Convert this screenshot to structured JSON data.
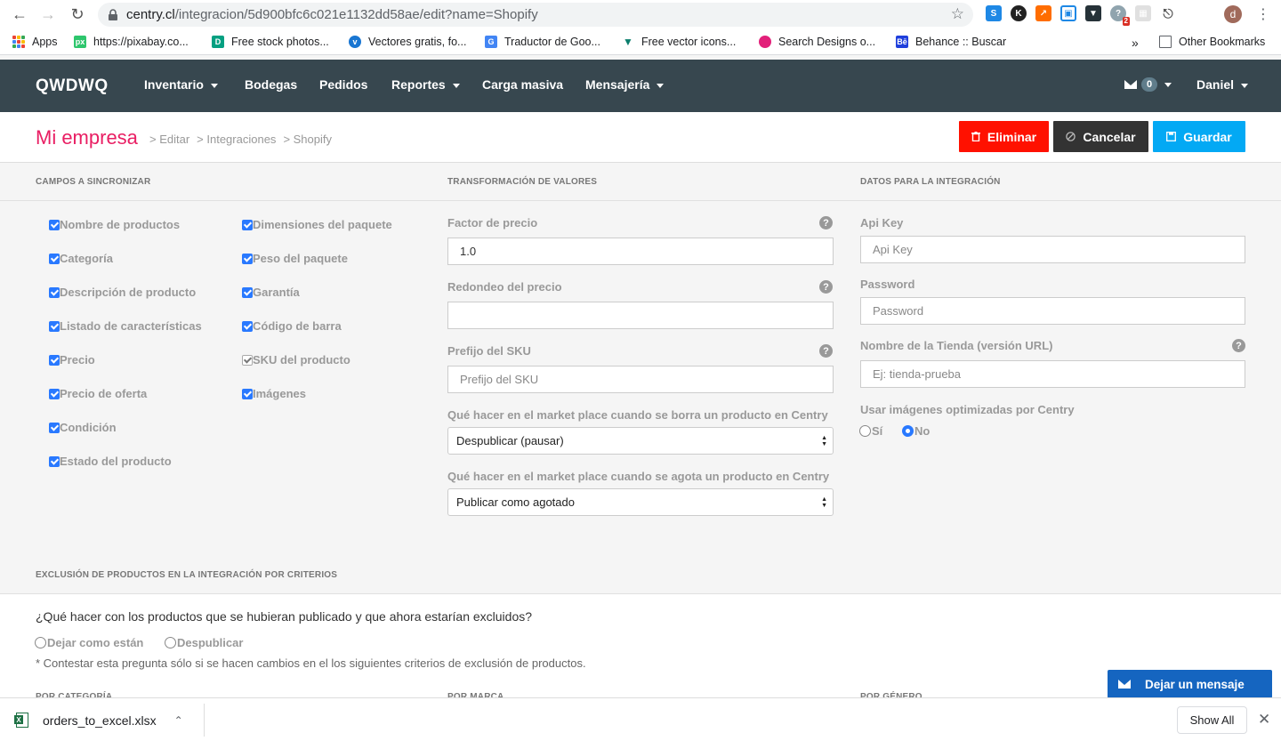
{
  "browser": {
    "url_host": "centry.cl",
    "url_path": "/integracion/5d900bfc6c021e1132dd58ae/edit?name=Shopify",
    "bookmarks": [
      {
        "label": "Apps"
      },
      {
        "label": "https://pixabay.co..."
      },
      {
        "label": "Free stock photos..."
      },
      {
        "label": "Vectores gratis, fo..."
      },
      {
        "label": "Traductor de Goo..."
      },
      {
        "label": "Free vector icons..."
      },
      {
        "label": "Search Designs o..."
      },
      {
        "label": "Behance :: Buscar"
      },
      {
        "label": "Other Bookmarks"
      }
    ],
    "ext_badge": "2",
    "profile_initial": "d"
  },
  "nav": {
    "brand": "QWDWQ",
    "items": [
      {
        "label": "Inventario",
        "dropdown": true
      },
      {
        "label": "Bodegas",
        "dropdown": false
      },
      {
        "label": "Pedidos",
        "dropdown": false
      },
      {
        "label": "Reportes",
        "dropdown": true
      },
      {
        "label": "Carga masiva",
        "dropdown": false
      },
      {
        "label": "Mensajería",
        "dropdown": true
      }
    ],
    "message_count": "0",
    "user": "Daniel"
  },
  "header": {
    "title": "Mi empresa",
    "breadcrumbs": [
      "> Editar",
      "> Integraciones",
      "> Shopify"
    ],
    "btn_delete": "Eliminar",
    "btn_cancel": "Cancelar",
    "btn_save": "Guardar"
  },
  "sync": {
    "section_label": "CAMPOS A SINCRONIZAR",
    "col1": [
      "Nombre de productos",
      "Categoría",
      "Descripción de producto",
      "Listado de características",
      "Precio",
      "Precio de oferta",
      "Condición",
      "Estado del producto"
    ],
    "col2": [
      "Dimensiones del paquete",
      "Peso del paquete",
      "Garantía",
      "Código de barra",
      "SKU del producto",
      "Imágenes"
    ]
  },
  "transform": {
    "section_label": "TRANSFORMACIÓN DE VALORES",
    "price_factor_label": "Factor de precio",
    "price_factor_value": "1.0",
    "rounding_label": "Redondeo del precio",
    "sku_prefix_label": "Prefijo del SKU",
    "sku_prefix_placeholder": "Prefijo del SKU",
    "on_delete_label": "Qué hacer en el market place cuando se borra un producto en Centry",
    "on_delete_value": "Despublicar (pausar)",
    "on_soldout_label": "Qué hacer en el market place cuando se agota un producto en Centry",
    "on_soldout_value": "Publicar como agotado"
  },
  "integration": {
    "section_label": "DATOS PARA LA INTEGRACIÓN",
    "api_key_label": "Api Key",
    "api_key_placeholder": "Api Key",
    "password_label": "Password",
    "password_placeholder": "Password",
    "store_label": "Nombre de la Tienda (versión URL)",
    "store_placeholder": "Ej: tienda-prueba",
    "optimized_label": "Usar imágenes optimizadas por Centry",
    "opt_yes": "Sí",
    "opt_no": "No"
  },
  "exclusion": {
    "section_label": "EXCLUSIÓN DE PRODUCTOS EN LA INTEGRACIÓN POR CRITERIOS",
    "question": "¿Qué hacer con los productos que se hubieran publicado y que ahora estarían excluidos?",
    "opt_keep": "Dejar como están",
    "opt_unpublish": "Despublicar",
    "note": "* Contestar esta pregunta sólo si se hacen cambios en el los siguientes criterios de exclusión de productos.",
    "by_category": "POR CATEGORÍA",
    "by_brand": "POR MARCA",
    "by_gender": "POR GÉNERO"
  },
  "chat": {
    "label": "Dejar un mensaje"
  },
  "download": {
    "file": "orders_to_excel.xlsx",
    "show_all": "Show All"
  }
}
